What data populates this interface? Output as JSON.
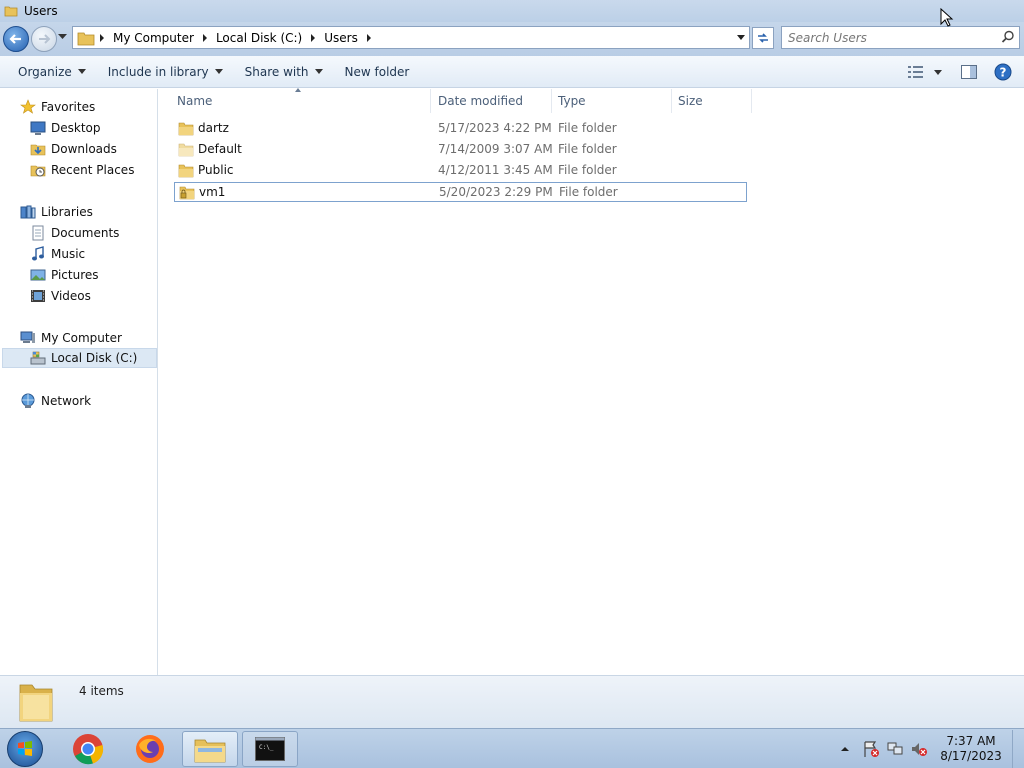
{
  "window": {
    "title": "Users"
  },
  "address": {
    "breadcrumbs": [
      "My Computer",
      "Local Disk (C:)",
      "Users"
    ],
    "search_placeholder": "Search Users"
  },
  "toolbar": {
    "organize": "Organize",
    "include_in_library": "Include in library",
    "share_with": "Share with",
    "new_folder": "New folder"
  },
  "nav": {
    "favorites": "Favorites",
    "desktop": "Desktop",
    "downloads": "Downloads",
    "recent_places": "Recent Places",
    "libraries": "Libraries",
    "documents": "Documents",
    "music": "Music",
    "pictures": "Pictures",
    "videos": "Videos",
    "my_computer": "My Computer",
    "local_disk": "Local Disk (C:)",
    "network": "Network"
  },
  "columns": {
    "name": "Name",
    "date_modified": "Date modified",
    "type": "Type",
    "size": "Size"
  },
  "files": [
    {
      "name": "dartz",
      "date": "5/17/2023 4:22 PM",
      "type": "File folder"
    },
    {
      "name": "Default",
      "date": "7/14/2009 3:07 AM",
      "type": "File folder"
    },
    {
      "name": "Public",
      "date": "4/12/2011 3:45 AM",
      "type": "File folder"
    },
    {
      "name": "vm1",
      "date": "5/20/2023 2:29 PM",
      "type": "File folder"
    }
  ],
  "details": {
    "item_count": "4 items"
  },
  "taskbar": {
    "time": "7:37 AM",
    "date": "8/17/2023"
  },
  "colors": {
    "folder": "#e8c25a",
    "selection_border": "#7da2ce",
    "accent_blue": "#2460b0"
  }
}
